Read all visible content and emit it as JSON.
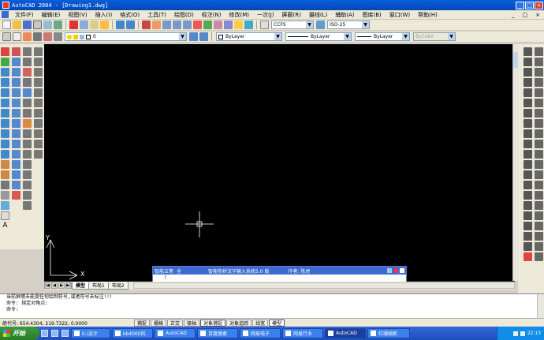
{
  "window": {
    "title": "AutoCAD 2004 - [Drawing1.dwg]",
    "controls": [
      "_",
      "□",
      "×"
    ]
  },
  "menu": {
    "items": [
      "文件(F)",
      "编辑(E)",
      "视图(V)",
      "插入(I)",
      "格式(O)",
      "工具(T)",
      "绘图(D)",
      "标注(N)",
      "修改(M)",
      "一次(J)",
      "屏蔽(R)",
      "摄线(L)",
      "辅助(A)",
      "图库(B)",
      "窗口(W)",
      "帮助(H)"
    ],
    "doc_controls": [
      "_",
      "□",
      "×"
    ]
  },
  "toolbar1": {
    "text_style": "CCFS",
    "dim_style": "ISO-25"
  },
  "toolbar2": {
    "layer": "0",
    "color": "ByLayer",
    "linetype": "ByLayer",
    "lineweight": "ByLayer",
    "plotstyle": "ByColor"
  },
  "ucs": {
    "y": "Y",
    "x": "X"
  },
  "ime": {
    "row1": [
      "智能五笔",
      "全",
      "",
      "智能陈桥汉字输入系统5.0 版",
      "作者: 陈虎"
    ],
    "row2": [
      "?"
    ]
  },
  "tabs": {
    "model": "模型",
    "layout1": "布局1",
    "layout2": "布局2"
  },
  "command": {
    "lines": [
      "当前屏缠未能提任何绘制符号,或者符号未标注!!!",
      "命令: 指定对角点:",
      "命令:"
    ]
  },
  "status": {
    "coords": "绝代号: 654.4304, 219.7322, 0.0000",
    "buttons": [
      {
        "label": "捕捉",
        "on": false
      },
      {
        "label": "栅格",
        "on": false
      },
      {
        "label": "正交",
        "on": false
      },
      {
        "label": "极轴",
        "on": false
      },
      {
        "label": "对象捕捉",
        "on": true
      },
      {
        "label": "对象追踪",
        "on": false
      },
      {
        "label": "线宽",
        "on": false
      },
      {
        "label": "模型",
        "on": true
      }
    ]
  },
  "taskbar": {
    "start": "开始",
    "tasks": [
      {
        "label": "E:\\设计",
        "active": false
      },
      {
        "label": "kb4000风",
        "active": false
      },
      {
        "label": "AutoCAD",
        "active": false
      },
      {
        "label": "百度搜索",
        "active": false
      },
      {
        "label": "网易电子",
        "active": false
      },
      {
        "label": "网易行业",
        "active": false
      },
      {
        "label": "AutoCAD",
        "active": true
      },
      {
        "label": "红珊瑚抓",
        "active": false
      }
    ],
    "clock": "22:13"
  }
}
